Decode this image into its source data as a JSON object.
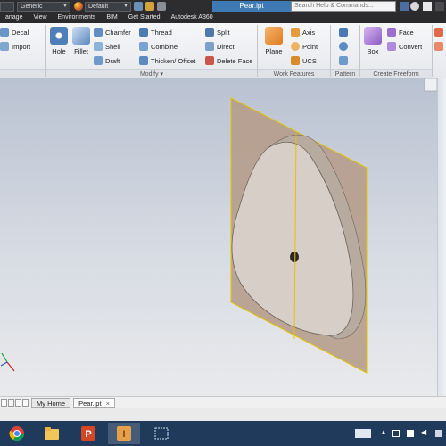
{
  "titlebar": {
    "material": "Generic",
    "appearance": "Default",
    "document_title": "Pear.ipt",
    "search_placeholder": "Search Help & Commands..."
  },
  "tabs": [
    {
      "label": "anage"
    },
    {
      "label": "View"
    },
    {
      "label": "Environments"
    },
    {
      "label": "BIM"
    },
    {
      "label": "Get Started"
    },
    {
      "label": "Autodesk A360"
    }
  ],
  "ribbon": {
    "left": {
      "decal": "Decal",
      "import": "Import"
    },
    "modify": {
      "hole": "Hole",
      "fillet": "Fillet",
      "chamfer": "Chamfer",
      "shell": "Shell",
      "draft": "Draft",
      "thread": "Thread",
      "combine": "Combine",
      "thicken_offset": "Thicken/ Offset",
      "split": "Split",
      "direct": "Direct",
      "delete_face": "Delete Face",
      "panel_label": "Modify ▾"
    },
    "work_features": {
      "plane": "Plane",
      "axis": "Axis",
      "point": "Point",
      "ucs": "UCS",
      "panel_label": "Work Features"
    },
    "pattern": {
      "panel_label": "Pattern"
    },
    "freeform": {
      "box": "Box",
      "face": "Face",
      "convert": "Convert",
      "panel_label": "Create Freeform"
    }
  },
  "doc_tabs": [
    {
      "label": "My Home"
    },
    {
      "label": "Pear.ipt"
    }
  ],
  "colors": {
    "work_plane_fill": "#b49a86",
    "work_plane_edge": "#e6c200",
    "part_fill": "#d7cfc7",
    "taskbar": "#1f3a5a"
  }
}
